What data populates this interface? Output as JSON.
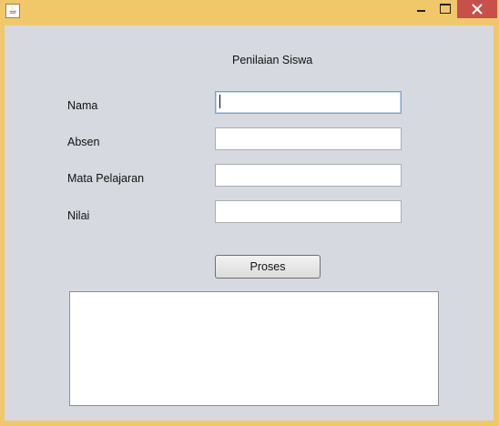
{
  "window": {
    "title": "",
    "icon": "java-cup-icon",
    "controls": [
      "minimize",
      "maximize",
      "close"
    ]
  },
  "form": {
    "title": "Penilaian Siswa",
    "fields": [
      {
        "label": "Nama",
        "value": "",
        "focused": true
      },
      {
        "label": "Absen",
        "value": ""
      },
      {
        "label": "Mata Pelajaran",
        "value": ""
      },
      {
        "label": "Nilai",
        "value": ""
      }
    ],
    "submit_label": "Proses",
    "output_text": ""
  },
  "colors": {
    "title_bar": "#f0c86a",
    "client_background": "#d6d9e0",
    "close_button": "#c7504a"
  }
}
